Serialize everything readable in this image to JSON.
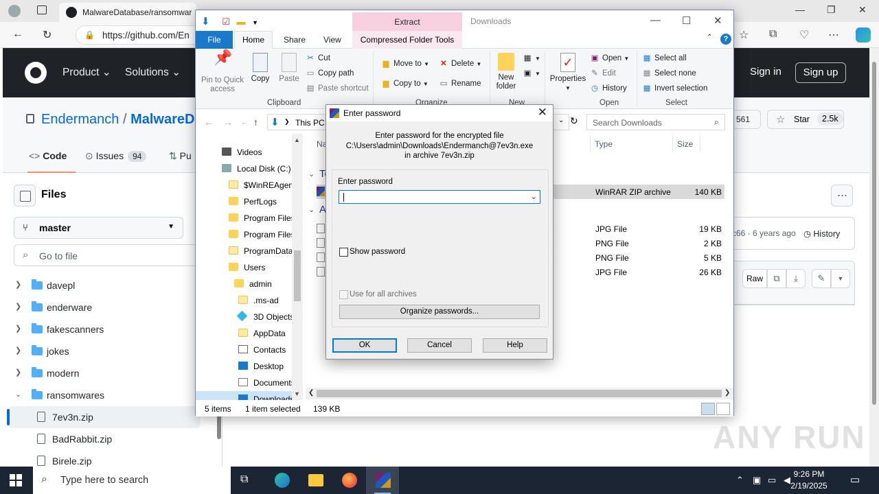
{
  "browser": {
    "tab_title": "MalwareDatabase/ransomware",
    "url": "https://github.com/En"
  },
  "github": {
    "nav": [
      "Product",
      "Solutions"
    ],
    "signin": "Sign in",
    "signup": "Sign up",
    "repo_owner": "Endermanch",
    "repo_sep": "/",
    "repo_name": "MalwareDa",
    "tabs": {
      "code": "Code",
      "issues": "Issues",
      "issues_count": "94",
      "pulls": "Pu"
    },
    "star_label": "Star",
    "star_count": "2.5k",
    "fork_count": "561",
    "files_title": "Files",
    "branch": "master",
    "goto_placeholder": "Go to file",
    "tree": [
      {
        "label": "davepl",
        "type": "folder",
        "expanded": false
      },
      {
        "label": "enderware",
        "type": "folder",
        "expanded": false
      },
      {
        "label": "fakescanners",
        "type": "folder",
        "expanded": false
      },
      {
        "label": "jokes",
        "type": "folder",
        "expanded": false
      },
      {
        "label": "modern",
        "type": "folder",
        "expanded": false
      },
      {
        "label": "ransomwares",
        "type": "folder",
        "expanded": true
      },
      {
        "label": "7ev3n.zip",
        "type": "file",
        "selected": true
      },
      {
        "label": "BadRabbit.zip",
        "type": "file"
      },
      {
        "label": "Birele.zip",
        "type": "file"
      }
    ],
    "commit_ago": "c66 · 6 years ago",
    "history": "History",
    "raw": "Raw"
  },
  "explorer": {
    "title": "Downloads",
    "extract_tab": "Extract",
    "ribbon_tabs": {
      "file": "File",
      "home": "Home",
      "share": "Share",
      "view": "View",
      "compressed": "Compressed Folder Tools"
    },
    "clipboard": {
      "pin": "Pin to Quick access",
      "copy": "Copy",
      "paste": "Paste",
      "cut": "Cut",
      "copy_path": "Copy path",
      "paste_shortcut": "Paste shortcut",
      "label": "Clipboard"
    },
    "organize": {
      "move_to": "Move to",
      "copy_to": "Copy to",
      "delete": "Delete",
      "rename": "Rename",
      "label": "Organize"
    },
    "new": {
      "new_folder": "New folder",
      "label": "New"
    },
    "open": {
      "properties": "Properties",
      "open": "Open",
      "edit": "Edit",
      "history": "History",
      "label": "Open"
    },
    "select": {
      "select_all": "Select all",
      "select_none": "Select none",
      "invert": "Invert selection",
      "label": "Select"
    },
    "address": "This PC",
    "search_placeholder": "Search Downloads",
    "nav_items": [
      {
        "label": "Videos",
        "indent": 1,
        "icon": "videos"
      },
      {
        "label": "Local Disk (C:)",
        "indent": 0,
        "icon": "disk"
      },
      {
        "label": "$WinREAgent",
        "indent": 2,
        "icon": "folder-light"
      },
      {
        "label": "PerfLogs",
        "indent": 2,
        "icon": "folder"
      },
      {
        "label": "Program Files",
        "indent": 2,
        "icon": "folder"
      },
      {
        "label": "Program Files",
        "indent": 2,
        "icon": "folder"
      },
      {
        "label": "ProgramData",
        "indent": 2,
        "icon": "folder-light"
      },
      {
        "label": "Users",
        "indent": 2,
        "icon": "folder"
      },
      {
        "label": "admin",
        "indent": 3,
        "icon": "folder"
      },
      {
        "label": ".ms-ad",
        "indent": 4,
        "icon": "folder-light"
      },
      {
        "label": "3D Objects",
        "indent": 4,
        "icon": "3d"
      },
      {
        "label": "AppData",
        "indent": 4,
        "icon": "folder-light"
      },
      {
        "label": "Contacts",
        "indent": 4,
        "icon": "contacts"
      },
      {
        "label": "Desktop",
        "indent": 4,
        "icon": "desktop"
      },
      {
        "label": "Documents",
        "indent": 4,
        "icon": "documents"
      },
      {
        "label": "Downloads",
        "indent": 4,
        "icon": "downloads",
        "selected": true
      }
    ],
    "columns": {
      "name": "Na",
      "type": "Type",
      "size": "Size"
    },
    "group_today": "To",
    "group_earlier": "A",
    "files": [
      {
        "time": "PM",
        "type": "WinRAR ZIP archive",
        "size": "140 KB",
        "selected": true
      },
      {
        "time": "AM",
        "type": "JPG File",
        "size": "19 KB"
      },
      {
        "time": "AM",
        "type": "PNG File",
        "size": "2 KB"
      },
      {
        "time": "AM",
        "type": "PNG File",
        "size": "5 KB"
      },
      {
        "time": "M",
        "type": "JPG File",
        "size": "26 KB"
      }
    ],
    "status_items": "5 items",
    "status_selected": "1 item selected",
    "status_size": "139 KB"
  },
  "dialog": {
    "title": "Enter password",
    "msg_line1": "Enter password for the encrypted file",
    "msg_line2": "C:\\Users\\admin\\Downloads\\Endermanch@7ev3n.exe",
    "msg_line3": "in archive 7ev3n.zip",
    "pw_label": "Enter password",
    "pw_value": "",
    "show_password": "Show password",
    "use_all": "Use for all archives",
    "organize": "Organize passwords...",
    "ok": "OK",
    "cancel": "Cancel",
    "help": "Help"
  },
  "watermark": "ANY RUN",
  "taskbar": {
    "search_placeholder": "Type here to search",
    "time": "9:26 PM",
    "date": "2/19/2025"
  },
  "colors": {
    "github_header": "#1f2328",
    "accent": "#0969da",
    "explorer_file_tab": "#1979ca",
    "extract_tab": "#f9d0e0",
    "taskbar": "#1c2533"
  }
}
